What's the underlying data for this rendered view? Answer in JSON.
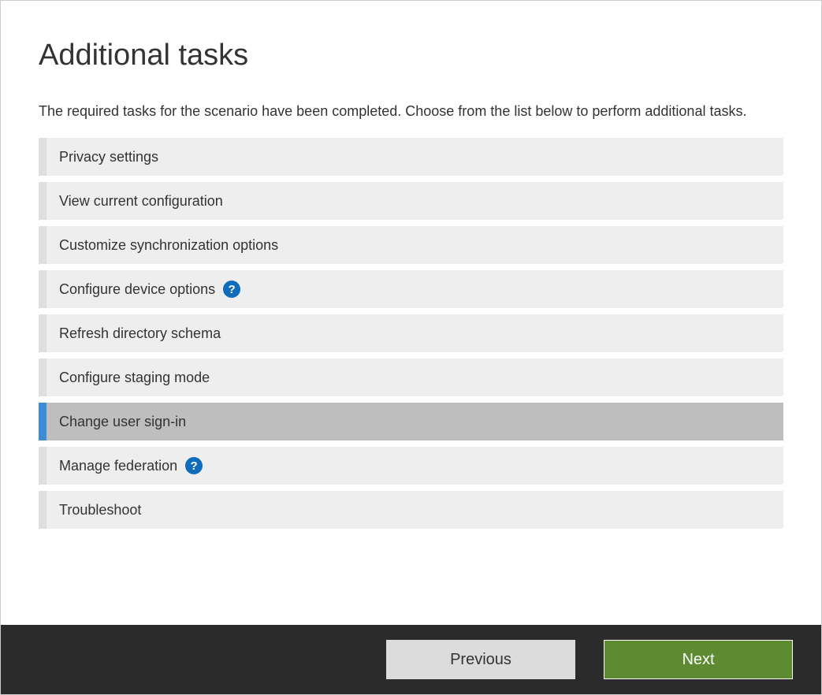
{
  "page": {
    "title": "Additional tasks",
    "description": "The required tasks for the scenario have been completed. Choose from the list below to perform additional tasks."
  },
  "tasks": [
    {
      "label": "Privacy settings",
      "selected": false,
      "help": false
    },
    {
      "label": "View current configuration",
      "selected": false,
      "help": false
    },
    {
      "label": "Customize synchronization options",
      "selected": false,
      "help": false
    },
    {
      "label": "Configure device options",
      "selected": false,
      "help": true
    },
    {
      "label": "Refresh directory schema",
      "selected": false,
      "help": false
    },
    {
      "label": "Configure staging mode",
      "selected": false,
      "help": false
    },
    {
      "label": "Change user sign-in",
      "selected": true,
      "help": false
    },
    {
      "label": "Manage federation",
      "selected": false,
      "help": true
    },
    {
      "label": "Troubleshoot",
      "selected": false,
      "help": false
    }
  ],
  "footer": {
    "previous": "Previous",
    "next": "Next"
  },
  "helpGlyph": "?"
}
